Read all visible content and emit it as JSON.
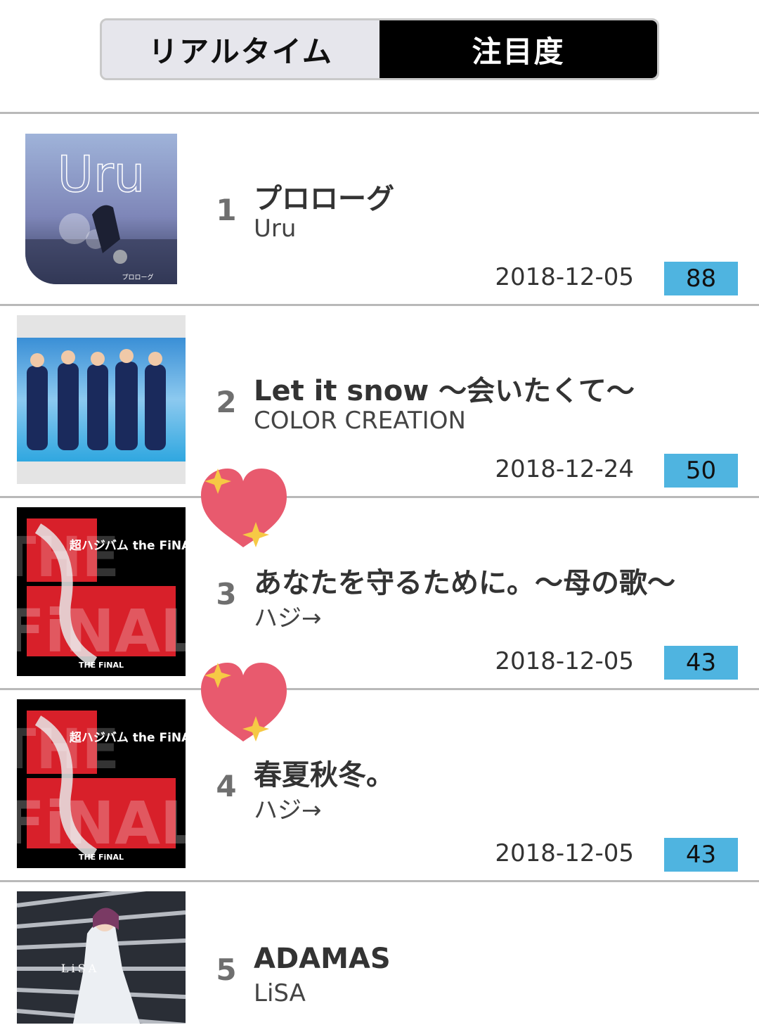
{
  "tabs": [
    {
      "label": "リアルタイム",
      "active": false
    },
    {
      "label": "注目度",
      "active": true
    }
  ],
  "rankings": [
    {
      "rank": "1",
      "title": "プロローグ",
      "artist": "Uru",
      "date": "2018-12-05",
      "score": "88",
      "cover_text": "Uru",
      "cover_subtext": "プロローグ"
    },
    {
      "rank": "2",
      "title": "Let it snow 〜会いたくて〜",
      "artist": "COLOR CREATION",
      "date": "2018-12-24",
      "score": "50"
    },
    {
      "rank": "3",
      "title": "あなたを守るために。〜母の歌〜",
      "artist": "ハジ→",
      "date": "2018-12-05",
      "score": "43",
      "cover_text": "THE FiNAL",
      "cover_subtext": "超ハジバム the FiNAL。"
    },
    {
      "rank": "4",
      "title": "春夏秋冬。",
      "artist": "ハジ→",
      "date": "2018-12-05",
      "score": "43",
      "cover_text": "THE FiNAL",
      "cover_subtext": "超ハジバム the FiNAL。"
    },
    {
      "rank": "5",
      "title": "ADAMAS",
      "artist": "LiSA",
      "cover_text": "LiSA"
    }
  ],
  "colors": {
    "score_bg": "#4fb4e0",
    "heart": "#e85a6e",
    "sparkle": "#f6c945",
    "active_tab": "#000000"
  },
  "icons": [
    "sparkling-heart-icon",
    "sparkling-heart-icon"
  ]
}
